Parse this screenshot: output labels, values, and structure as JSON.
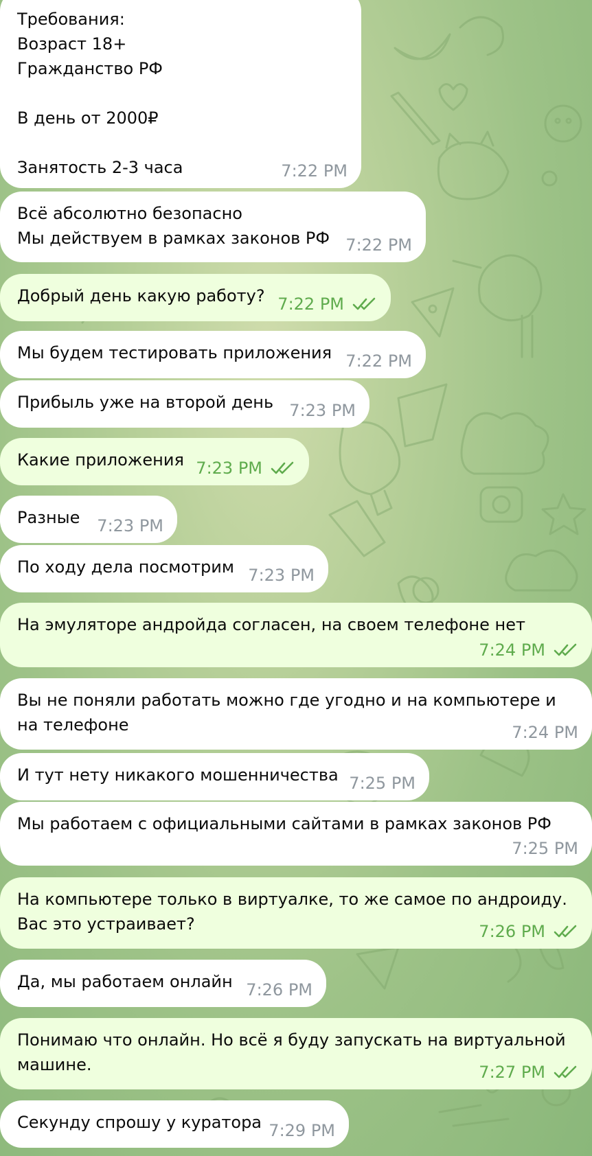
{
  "messages": [
    {
      "dir": "in",
      "text": "Требования:\nВозраст 18+\nГражданство РФ\n\nВ день от 2000₽\n\nЗанятость 2-3 часа",
      "time": "7:22 PM"
    },
    {
      "dir": "in",
      "text": "Всё абсолютно безопасно\nМы действуем в рамках законов РФ",
      "time": "7:22 PM"
    },
    {
      "dir": "out",
      "text": "Добрый день какую работу?",
      "time": "7:22 PM",
      "read": true
    },
    {
      "dir": "in",
      "text": "Мы будем тестировать приложения",
      "time": "7:22 PM"
    },
    {
      "dir": "in",
      "text": "Прибыль уже на второй день",
      "time": "7:23 PM"
    },
    {
      "dir": "out",
      "text": "Какие приложения",
      "time": "7:23 PM",
      "read": true
    },
    {
      "dir": "in",
      "text": "Разные",
      "time": "7:23 PM"
    },
    {
      "dir": "in",
      "text": "По ходу дела посмотрим",
      "time": "7:23 PM"
    },
    {
      "dir": "out",
      "text": "На эмуляторе андройда согласен, на своем телефоне нет",
      "time": "7:24 PM",
      "read": true
    },
    {
      "dir": "in",
      "text": "Вы не поняли работать можно где угодно и на компьютере и\nна телефоне",
      "time": "7:24 PM"
    },
    {
      "dir": "in",
      "text": "И тут нету никакого мошенничества",
      "time": "7:25 PM"
    },
    {
      "dir": "in",
      "text": "Мы работаем с официальными сайтами в рамках законов РФ",
      "time": "7:25 PM"
    },
    {
      "dir": "out",
      "text": "На компьютере только в виртуалке, то же самое по андроиду.\nВас это устраивает?",
      "time": "7:26 PM",
      "read": true
    },
    {
      "dir": "in",
      "text": "Да, мы работаем онлайн",
      "time": "7:26 PM"
    },
    {
      "dir": "out",
      "text": "Понимаю что онлайн. Но всё я буду запускать на виртуальной\nмашине.",
      "time": "7:27 PM",
      "read": true
    },
    {
      "dir": "in",
      "text": "Секунду спрошу у куратора",
      "time": "7:29 PM"
    }
  ],
  "colors": {
    "incoming_bubble": "#ffffff",
    "outgoing_bubble": "#efffde",
    "incoming_time": "#8f979e",
    "outgoing_time": "#5fab4d",
    "wallpaper": "#a8c88e"
  },
  "icons": {
    "read_receipt": "double-check-icon",
    "wallpaper_pattern": "doodle-pattern"
  }
}
